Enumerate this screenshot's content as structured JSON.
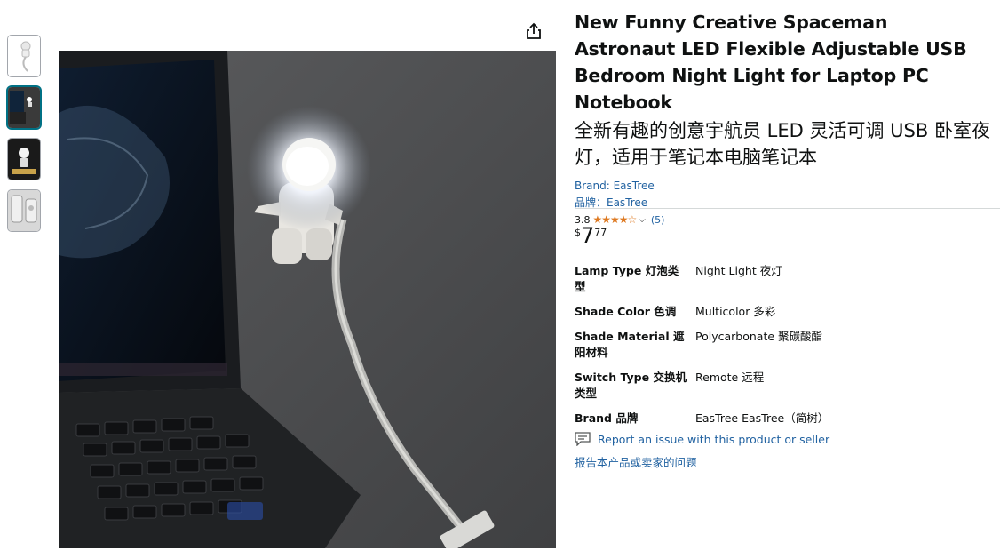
{
  "product": {
    "title_en": "New Funny Creative Spaceman Astronaut LED Flexible Adjustable USB Bedroom Night Light for Laptop PC Notebook",
    "title_cn": "全新有趣的创意宇航员 LED 灵活可调 USB 卧室夜灯，适用于笔记本电脑笔记本",
    "brand_en": "Brand: EasTree",
    "brand_cn": "品牌：EasTree",
    "rating": "3.8",
    "stars": "★★★★☆",
    "rating_count": "(5)",
    "price_symbol": "$",
    "price_whole": "7",
    "price_fraction": "77"
  },
  "specs": [
    {
      "key": "Lamp Type  灯泡类型",
      "value": "Night Light  夜灯"
    },
    {
      "key": "Shade Color  色调",
      "value": "Multicolor  多彩"
    },
    {
      "key": "Shade Material  遮阳材料",
      "value": "Polycarbonate  聚碳酸酯"
    },
    {
      "key": "Switch Type  交换机类型",
      "value": "Remote  远程"
    },
    {
      "key": "Brand  品牌",
      "value": "EasTree  EasTree（简树）"
    }
  ],
  "report": {
    "label_en": "Report an issue with this product or seller",
    "label_cn": "报告本产品或卖家的问题"
  },
  "icons": {
    "share": "share-icon",
    "report": "report-comment-icon",
    "chevron": "chevron-down-icon"
  },
  "colors": {
    "link": "#2162a1",
    "star": "#de7921",
    "thumb_selected": "#007185"
  }
}
